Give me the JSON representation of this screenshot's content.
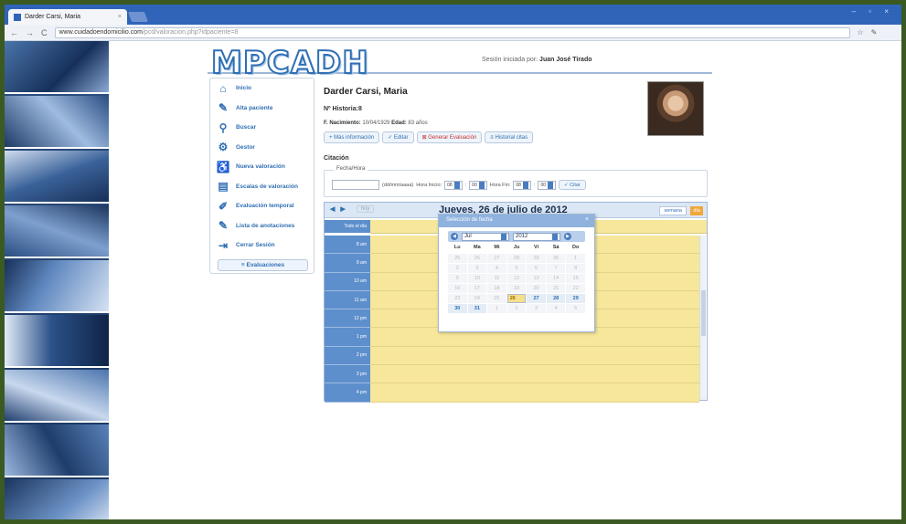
{
  "browser": {
    "tab_title": "Darder Carsi, Maria",
    "url_host": "www.cuidadoendomicilio.com",
    "url_path": "/pcd/valoracion.php?idpaciente=8",
    "window_controls": "– ▫ ×"
  },
  "header": {
    "logo": "MPCADH",
    "session_label": "Sesión iniciada por:",
    "session_user": "Juan José Tirado"
  },
  "sidebar": {
    "items": [
      {
        "label": "Inicio",
        "icon": "home-icon"
      },
      {
        "label": "Alta paciente",
        "icon": "pencil-icon"
      },
      {
        "label": "Buscar",
        "icon": "magnifier-icon"
      },
      {
        "label": "Gestor",
        "icon": "gears-icon"
      },
      {
        "label": "Nueva valoración",
        "icon": "wheelchair-icon"
      },
      {
        "label": "Escalas de valoración",
        "icon": "keyboard-icon"
      },
      {
        "label": "Evaluación temporal",
        "icon": "edit-icon"
      },
      {
        "label": "Lista de anotaciones",
        "icon": "pencil-icon"
      },
      {
        "label": "Cerrar Sesión",
        "icon": "logout-icon"
      }
    ],
    "evaluations_button": "Evaluaciones"
  },
  "patient": {
    "name": "Darder Carsi, Maria",
    "history_label": "Nº Historia:",
    "history_value": "8",
    "birth_label": "F. Nacimiento:",
    "birth_value": "10/04/1929",
    "age_label": "Edad:",
    "age_value": "83 años",
    "buttons": [
      "+ Más información",
      "✓ Editar",
      "⊠ Generar Evaluación",
      "≡ Historial citas"
    ]
  },
  "appointment": {
    "title": "Citación",
    "legend": "Fecha/Hora",
    "date_format": "(dd/mm/aaaa)",
    "start_label": "Hora Inicio:",
    "start_hour": "08",
    "start_min": "00",
    "end_label": "Hora Fin:",
    "end_hour": "08",
    "end_min": "00",
    "submit": "✓ Citar"
  },
  "calendar": {
    "today_button": "hoy",
    "title": "Jueves, 26 de julio de 2012",
    "week_button": "semana",
    "day_button": "día",
    "allday_label": "Todo el día",
    "hours": [
      "8 am",
      "9 am",
      "10 am",
      "11 am",
      "12 pm",
      "1 pm",
      "2 pm",
      "3 pm",
      "4 pm"
    ]
  },
  "datepicker": {
    "title": "Selección de fecha",
    "month": "Jul",
    "year": "2012",
    "weekdays": [
      "Lu",
      "Ma",
      "Mi",
      "Ju",
      "Vi",
      "Sá",
      "Do"
    ],
    "weeks": [
      [
        "25",
        "26",
        "27",
        "28",
        "29",
        "30",
        "1"
      ],
      [
        "2",
        "3",
        "4",
        "5",
        "6",
        "7",
        "8"
      ],
      [
        "9",
        "10",
        "11",
        "12",
        "13",
        "14",
        "15"
      ],
      [
        "16",
        "17",
        "18",
        "19",
        "20",
        "21",
        "22"
      ],
      [
        "23",
        "24",
        "25",
        "26",
        "27",
        "28",
        "29"
      ],
      [
        "30",
        "31",
        "1",
        "2",
        "3",
        "4",
        "5"
      ]
    ],
    "selected_day": "26"
  }
}
